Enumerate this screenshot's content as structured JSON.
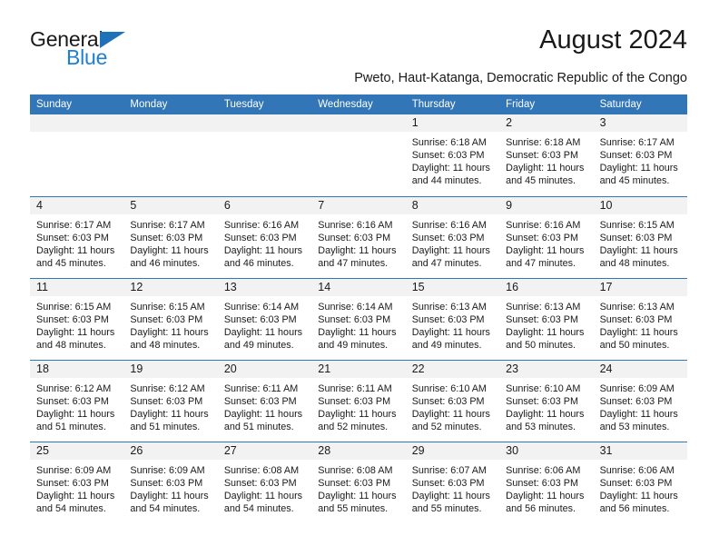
{
  "brand": {
    "name_part1": "General",
    "name_part2": "Blue",
    "accent_color": "#1f72b8",
    "blue_text_color": "#1f7fd0",
    "triangle_icon": "triangle-right-icon"
  },
  "header": {
    "title": "August 2024",
    "subtitle": "Pweto, Haut-Katanga, Democratic Republic of the Congo"
  },
  "theme": {
    "header_blue": "#3276b7",
    "daynum_band": "#f2f2f2",
    "text": "#1a1a1a"
  },
  "weekdays": [
    "Sunday",
    "Monday",
    "Tuesday",
    "Wednesday",
    "Thursday",
    "Friday",
    "Saturday"
  ],
  "weeks": [
    [
      {
        "day": "",
        "empty": true
      },
      {
        "day": "",
        "empty": true
      },
      {
        "day": "",
        "empty": true
      },
      {
        "day": "",
        "empty": true
      },
      {
        "day": "1",
        "sunrise": "Sunrise: 6:18 AM",
        "sunset": "Sunset: 6:03 PM",
        "daylight1": "Daylight: 11 hours",
        "daylight2": "and 44 minutes."
      },
      {
        "day": "2",
        "sunrise": "Sunrise: 6:18 AM",
        "sunset": "Sunset: 6:03 PM",
        "daylight1": "Daylight: 11 hours",
        "daylight2": "and 45 minutes."
      },
      {
        "day": "3",
        "sunrise": "Sunrise: 6:17 AM",
        "sunset": "Sunset: 6:03 PM",
        "daylight1": "Daylight: 11 hours",
        "daylight2": "and 45 minutes."
      }
    ],
    [
      {
        "day": "4",
        "sunrise": "Sunrise: 6:17 AM",
        "sunset": "Sunset: 6:03 PM",
        "daylight1": "Daylight: 11 hours",
        "daylight2": "and 45 minutes."
      },
      {
        "day": "5",
        "sunrise": "Sunrise: 6:17 AM",
        "sunset": "Sunset: 6:03 PM",
        "daylight1": "Daylight: 11 hours",
        "daylight2": "and 46 minutes."
      },
      {
        "day": "6",
        "sunrise": "Sunrise: 6:16 AM",
        "sunset": "Sunset: 6:03 PM",
        "daylight1": "Daylight: 11 hours",
        "daylight2": "and 46 minutes."
      },
      {
        "day": "7",
        "sunrise": "Sunrise: 6:16 AM",
        "sunset": "Sunset: 6:03 PM",
        "daylight1": "Daylight: 11 hours",
        "daylight2": "and 47 minutes."
      },
      {
        "day": "8",
        "sunrise": "Sunrise: 6:16 AM",
        "sunset": "Sunset: 6:03 PM",
        "daylight1": "Daylight: 11 hours",
        "daylight2": "and 47 minutes."
      },
      {
        "day": "9",
        "sunrise": "Sunrise: 6:16 AM",
        "sunset": "Sunset: 6:03 PM",
        "daylight1": "Daylight: 11 hours",
        "daylight2": "and 47 minutes."
      },
      {
        "day": "10",
        "sunrise": "Sunrise: 6:15 AM",
        "sunset": "Sunset: 6:03 PM",
        "daylight1": "Daylight: 11 hours",
        "daylight2": "and 48 minutes."
      }
    ],
    [
      {
        "day": "11",
        "sunrise": "Sunrise: 6:15 AM",
        "sunset": "Sunset: 6:03 PM",
        "daylight1": "Daylight: 11 hours",
        "daylight2": "and 48 minutes."
      },
      {
        "day": "12",
        "sunrise": "Sunrise: 6:15 AM",
        "sunset": "Sunset: 6:03 PM",
        "daylight1": "Daylight: 11 hours",
        "daylight2": "and 48 minutes."
      },
      {
        "day": "13",
        "sunrise": "Sunrise: 6:14 AM",
        "sunset": "Sunset: 6:03 PM",
        "daylight1": "Daylight: 11 hours",
        "daylight2": "and 49 minutes."
      },
      {
        "day": "14",
        "sunrise": "Sunrise: 6:14 AM",
        "sunset": "Sunset: 6:03 PM",
        "daylight1": "Daylight: 11 hours",
        "daylight2": "and 49 minutes."
      },
      {
        "day": "15",
        "sunrise": "Sunrise: 6:13 AM",
        "sunset": "Sunset: 6:03 PM",
        "daylight1": "Daylight: 11 hours",
        "daylight2": "and 49 minutes."
      },
      {
        "day": "16",
        "sunrise": "Sunrise: 6:13 AM",
        "sunset": "Sunset: 6:03 PM",
        "daylight1": "Daylight: 11 hours",
        "daylight2": "and 50 minutes."
      },
      {
        "day": "17",
        "sunrise": "Sunrise: 6:13 AM",
        "sunset": "Sunset: 6:03 PM",
        "daylight1": "Daylight: 11 hours",
        "daylight2": "and 50 minutes."
      }
    ],
    [
      {
        "day": "18",
        "sunrise": "Sunrise: 6:12 AM",
        "sunset": "Sunset: 6:03 PM",
        "daylight1": "Daylight: 11 hours",
        "daylight2": "and 51 minutes."
      },
      {
        "day": "19",
        "sunrise": "Sunrise: 6:12 AM",
        "sunset": "Sunset: 6:03 PM",
        "daylight1": "Daylight: 11 hours",
        "daylight2": "and 51 minutes."
      },
      {
        "day": "20",
        "sunrise": "Sunrise: 6:11 AM",
        "sunset": "Sunset: 6:03 PM",
        "daylight1": "Daylight: 11 hours",
        "daylight2": "and 51 minutes."
      },
      {
        "day": "21",
        "sunrise": "Sunrise: 6:11 AM",
        "sunset": "Sunset: 6:03 PM",
        "daylight1": "Daylight: 11 hours",
        "daylight2": "and 52 minutes."
      },
      {
        "day": "22",
        "sunrise": "Sunrise: 6:10 AM",
        "sunset": "Sunset: 6:03 PM",
        "daylight1": "Daylight: 11 hours",
        "daylight2": "and 52 minutes."
      },
      {
        "day": "23",
        "sunrise": "Sunrise: 6:10 AM",
        "sunset": "Sunset: 6:03 PM",
        "daylight1": "Daylight: 11 hours",
        "daylight2": "and 53 minutes."
      },
      {
        "day": "24",
        "sunrise": "Sunrise: 6:09 AM",
        "sunset": "Sunset: 6:03 PM",
        "daylight1": "Daylight: 11 hours",
        "daylight2": "and 53 minutes."
      }
    ],
    [
      {
        "day": "25",
        "sunrise": "Sunrise: 6:09 AM",
        "sunset": "Sunset: 6:03 PM",
        "daylight1": "Daylight: 11 hours",
        "daylight2": "and 54 minutes."
      },
      {
        "day": "26",
        "sunrise": "Sunrise: 6:09 AM",
        "sunset": "Sunset: 6:03 PM",
        "daylight1": "Daylight: 11 hours",
        "daylight2": "and 54 minutes."
      },
      {
        "day": "27",
        "sunrise": "Sunrise: 6:08 AM",
        "sunset": "Sunset: 6:03 PM",
        "daylight1": "Daylight: 11 hours",
        "daylight2": "and 54 minutes."
      },
      {
        "day": "28",
        "sunrise": "Sunrise: 6:08 AM",
        "sunset": "Sunset: 6:03 PM",
        "daylight1": "Daylight: 11 hours",
        "daylight2": "and 55 minutes."
      },
      {
        "day": "29",
        "sunrise": "Sunrise: 6:07 AM",
        "sunset": "Sunset: 6:03 PM",
        "daylight1": "Daylight: 11 hours",
        "daylight2": "and 55 minutes."
      },
      {
        "day": "30",
        "sunrise": "Sunrise: 6:06 AM",
        "sunset": "Sunset: 6:03 PM",
        "daylight1": "Daylight: 11 hours",
        "daylight2": "and 56 minutes."
      },
      {
        "day": "31",
        "sunrise": "Sunrise: 6:06 AM",
        "sunset": "Sunset: 6:03 PM",
        "daylight1": "Daylight: 11 hours",
        "daylight2": "and 56 minutes."
      }
    ]
  ]
}
